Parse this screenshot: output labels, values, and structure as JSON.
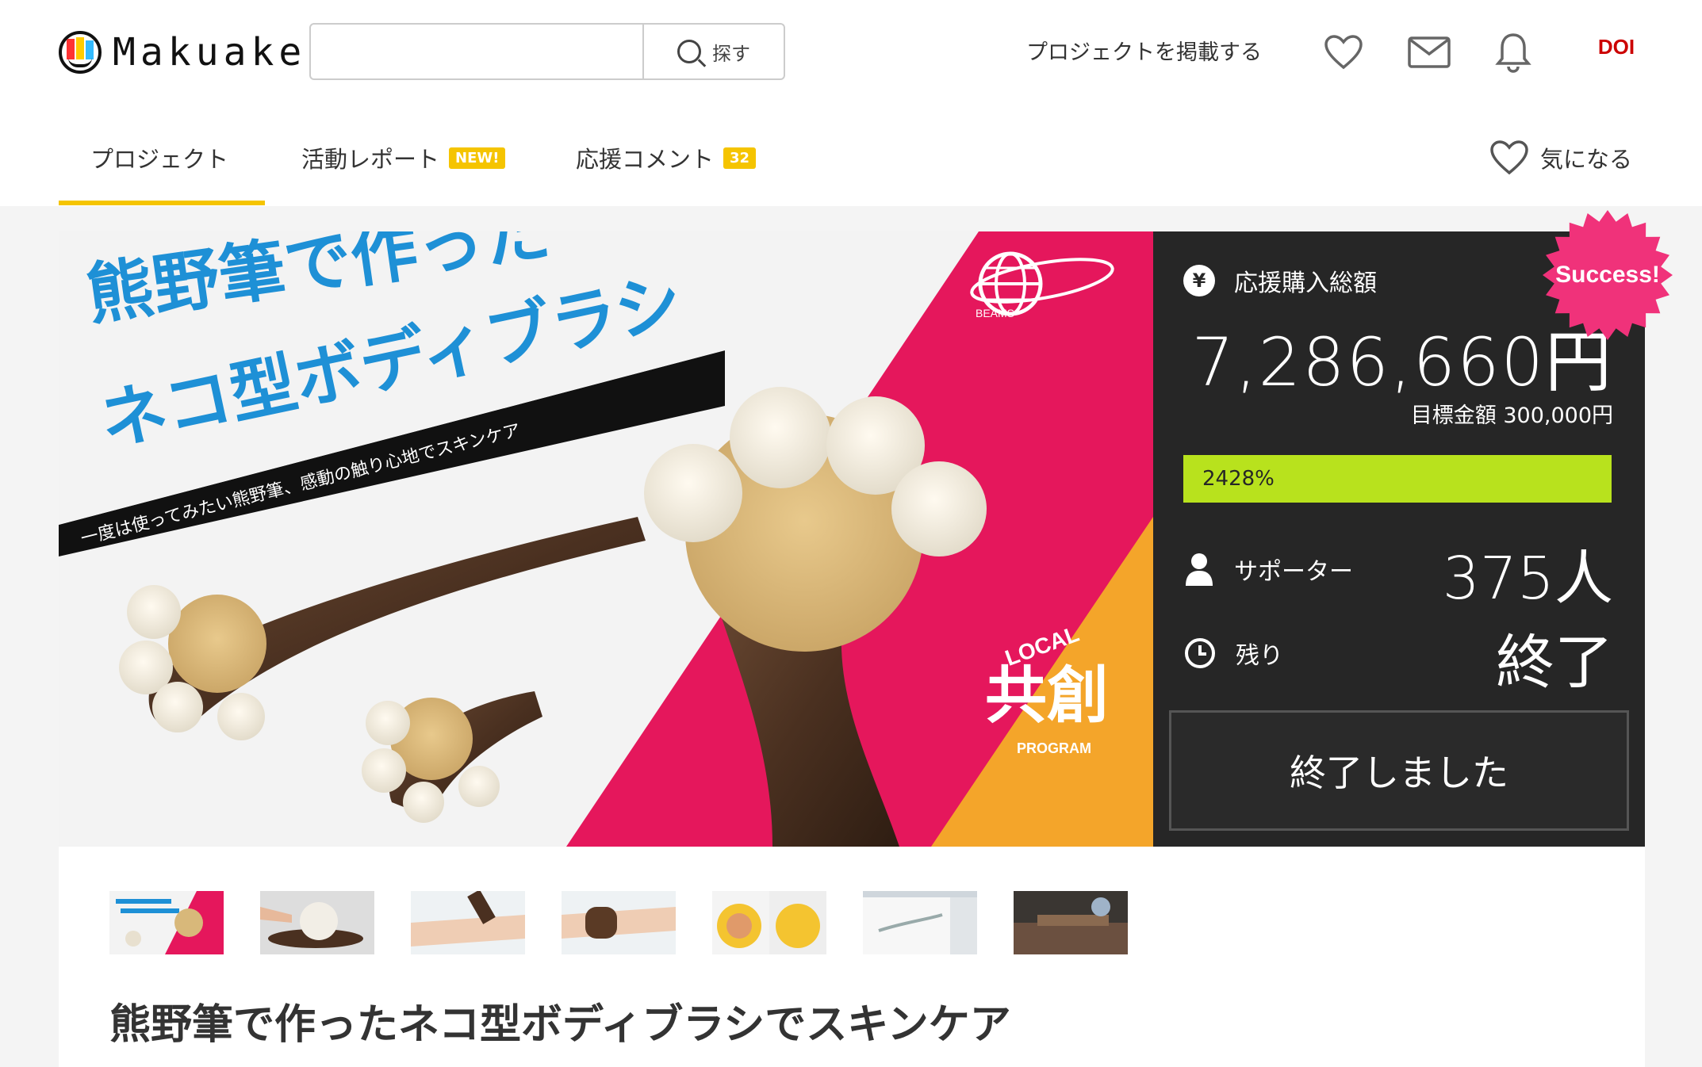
{
  "header": {
    "logo_text": "Makuake",
    "search_placeholder": "",
    "search_button": "探す",
    "post_project": "プロジェクトを掲載する",
    "user_logo_text": "DOI"
  },
  "tabs": [
    {
      "label": "プロジェクト"
    },
    {
      "label": "活動レポート",
      "badge": "NEW!"
    },
    {
      "label": "応援コメント",
      "badge": "32"
    }
  ],
  "favorite_label": "気になる",
  "hero": {
    "headline_1": "熊野筆で作った",
    "headline_2": "ネコ型ボディブラシ",
    "tagline": "一度は使ってみたい熊野筆、感動の触り心地でスキンケア",
    "brand": "BEAMS",
    "badge_top": "LOCAL",
    "badge_main": "共創",
    "badge_bottom": "PROGRAM"
  },
  "funding": {
    "success_badge": "Success!",
    "currency_icon": "¥",
    "total_label": "応援購入総額",
    "total_amount": "7,286,660円",
    "goal_text": "目標金額 300,000円",
    "progress_label": "2428%",
    "progress_fraction": 1.0,
    "supporters_label": "サポーター",
    "supporters_value": "375人",
    "remaining_label": "残り",
    "remaining_value": "終了",
    "ended_button": "終了しました"
  },
  "thumbnails": [
    "thumb-1",
    "thumb-2",
    "thumb-3",
    "thumb-4",
    "thumb-5",
    "thumb-6",
    "thumb-7"
  ],
  "project_title": "熊野筆で作ったネコ型ボディブラシでスキンケア",
  "colors": {
    "accent_yellow": "#f5c400",
    "panel_bg": "#262626",
    "progress_green": "#b8e21d",
    "success_pink": "#f0327a",
    "hero_blue": "#1e90d6",
    "hero_pink": "#e5175c",
    "hero_orange": "#f4a52a"
  }
}
